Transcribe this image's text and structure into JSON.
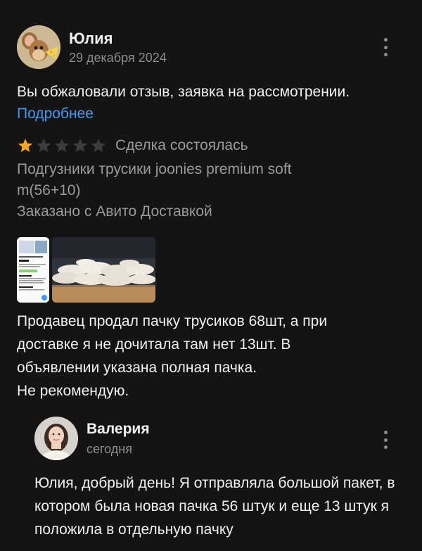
{
  "review": {
    "author_name": "Юлия",
    "date": "29 декабря 2024",
    "appeal_text": "Вы обжаловали отзыв, заявка на рассмотрении.",
    "appeal_link": "Подробнее",
    "rating": 1,
    "rating_max": 5,
    "star_color_filled": "#f5a623",
    "star_color_empty": "#3c3c3c",
    "deal_status": "Сделка состоялась",
    "product_line1": "Подгузники трусики joonies premium soft",
    "product_line2": "m(56+10)",
    "delivery": "Заказано с Авито Доставкой",
    "photos": [
      {
        "name": "listing-screenshot"
      },
      {
        "name": "diapers-photo"
      }
    ],
    "text": "Продавец продал пачку трусиков 68шт, а при\nдоставке я не дочитала там нет 13шт. В\nобъявлении указана полная пачка.\nНе рекомендую."
  },
  "reply": {
    "author_name": "Валерия",
    "date": "сегодня",
    "text": "Юлия, добрый день! Я отправляла большой пакет,  в котором была новая пачка 56 штук и еще 13 штук я положила в отдельную пачку"
  },
  "colors": {
    "background": "#141414",
    "link": "#3e9bf5",
    "secondary_text": "#9a9a9a"
  }
}
